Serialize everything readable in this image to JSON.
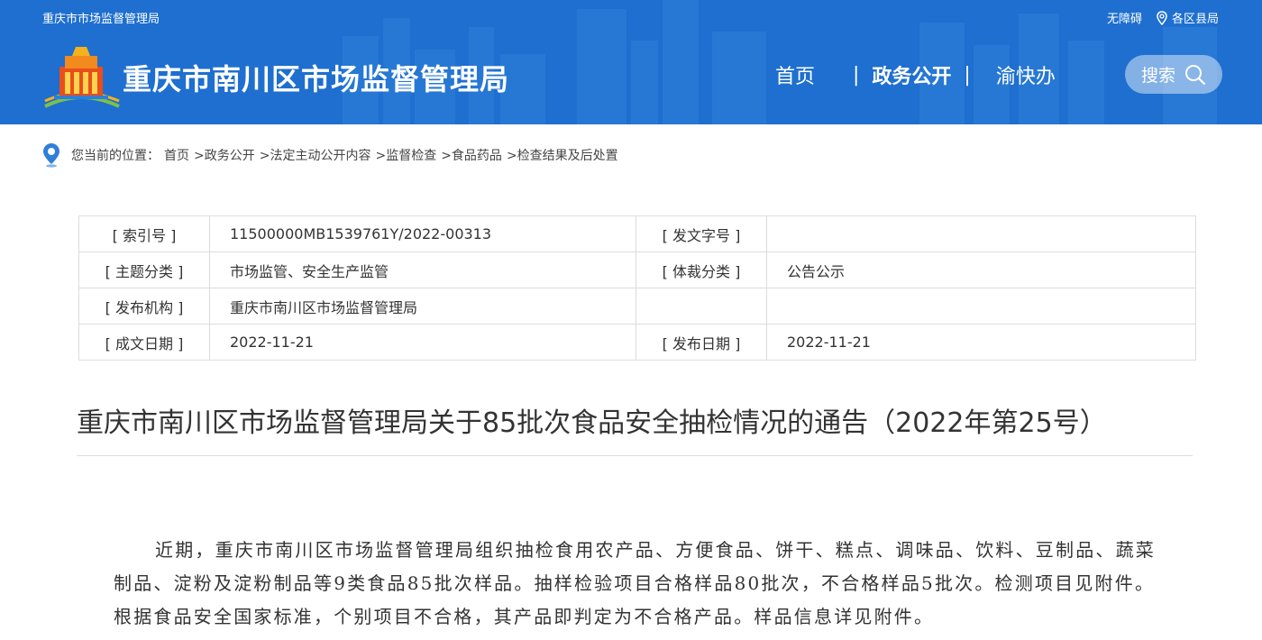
{
  "header": {
    "site_short_name": "重庆市市场监督管理局",
    "accessibility": "无障碍",
    "regions": "各区县局",
    "site_title": "重庆市南川区市场监督管理局",
    "nav": [
      {
        "label": "首页"
      },
      {
        "label": "政务公开"
      },
      {
        "label": "渝快办"
      }
    ],
    "search_label": "搜索",
    "colors": {
      "header_bg": "#1e6fcf"
    }
  },
  "breadcrumb": {
    "prefix": "您当前的位置：",
    "items": [
      "首页",
      ">政务公开",
      ">法定主动公开内容",
      ">监督检查",
      ">食品药品",
      ">检查结果及后处置"
    ]
  },
  "meta": {
    "index_label": "[ 索引号 ]",
    "index_value": "11500000MB1539761Y/2022-00313",
    "doc_no_label": "[ 发文字号 ]",
    "doc_no_value": "",
    "topic_label": "[ 主题分类 ]",
    "topic_value": "市场监管、安全生产监管",
    "genre_label": "[ 体裁分类 ]",
    "genre_value": "公告公示",
    "publisher_label": "[ 发布机构 ]",
    "publisher_value": "重庆市南川区市场监督管理局",
    "created_label": "[ 成文日期 ]",
    "created_value": "2022-11-21",
    "published_label": "[ 发布日期 ]",
    "published_value": "2022-11-21"
  },
  "article": {
    "title": "重庆市南川区市场监督管理局关于85批次食品安全抽检情况的通告（2022年第25号）",
    "paragraph": "近期，重庆市南川区市场监督管理局组织抽检食用农产品、方便食品、饼干、糕点、调味品、饮料、豆制品、蔬菜制品、淀粉及淀粉制品等9类食品85批次样品。抽样检验项目合格样品80批次，不合格样品5批次。检测项目见附件。根据食品安全国家标准，个别项目不合格，其产品即判定为不合格产品。样品信息详见附件。"
  }
}
